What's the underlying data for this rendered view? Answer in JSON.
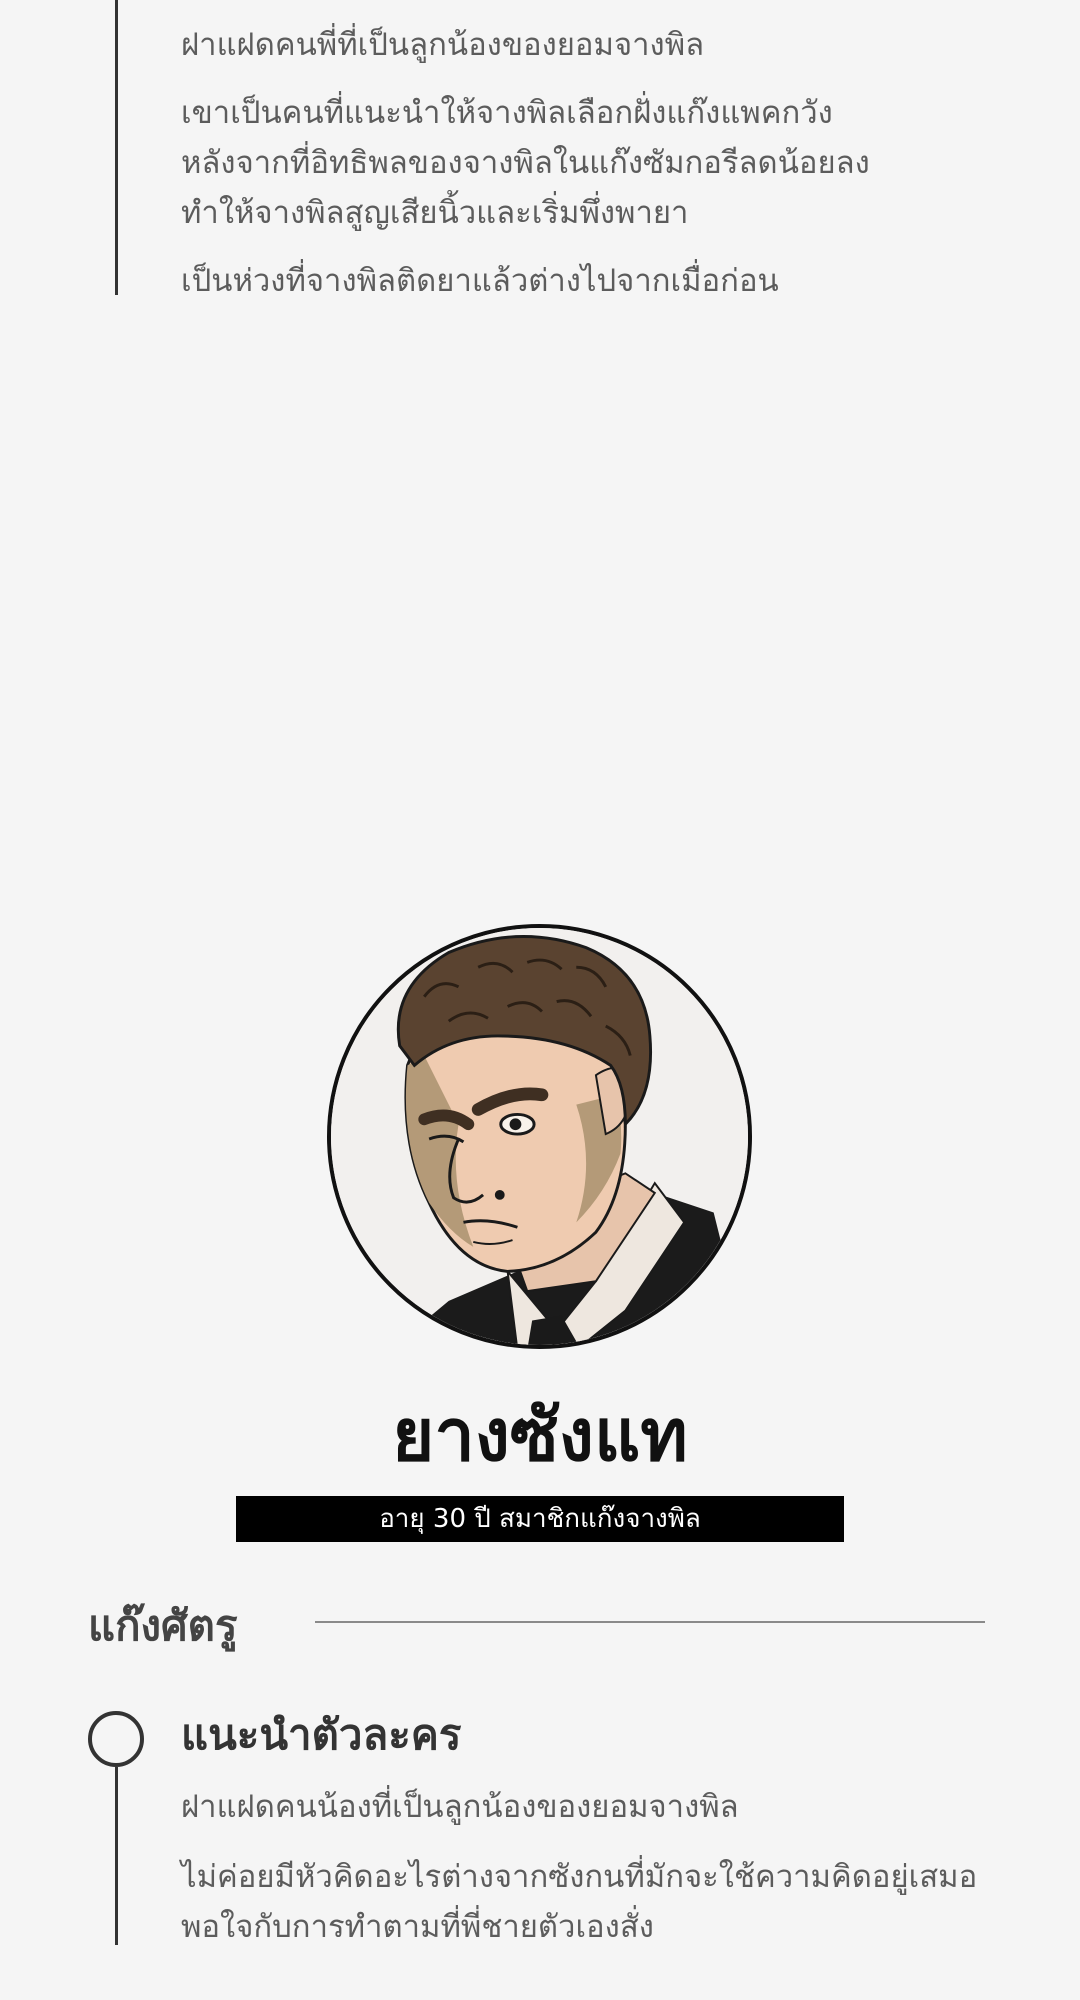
{
  "previous_character": {
    "paragraphs": [
      [
        "ฝาแฝดคนพี่ที่เป็นลูกน้องของยอมจางพิล"
      ],
      [
        "เขาเป็นคนที่แนะนำให้จางพิลเลือกฝั่งแก๊งแพคกวัง",
        "หลังจากที่อิทธิพลของจางพิลในแก๊งซัมกอรีลดน้อยลง",
        "ทำให้จางพิลสูญเสียนิ้วและเริ่มพึ่งพายา"
      ],
      [
        "เป็นห่วงที่จางพิลติดยาแล้วต่างไปจากเมื่อก่อน"
      ]
    ]
  },
  "character": {
    "portrait_icon": "character-portrait",
    "name": "ยางซังแท",
    "info": "อายุ 30 ปี สมาชิกแก๊งจางพิล"
  },
  "section": {
    "title": "แก๊งศัตรู"
  },
  "intro": {
    "heading": "แนะนำตัวละคร",
    "paragraphs": [
      [
        "ฝาแฝดคนน้องที่เป็นลูกน้องของยอมจางพิล"
      ],
      [
        "ไม่ค่อยมีหัวคิดอะไรต่างจากซังกนที่มักจะใช้ความคิดอยู่เสมอ",
        "พอใจกับการทำตามที่พี่ชายตัวเองสั่ง"
      ]
    ]
  },
  "colors": {
    "background": "#f5f5f5",
    "text_primary": "#111111",
    "text_secondary": "#5c5c5c",
    "bar_background": "#000000",
    "bar_text": "#ffffff"
  }
}
